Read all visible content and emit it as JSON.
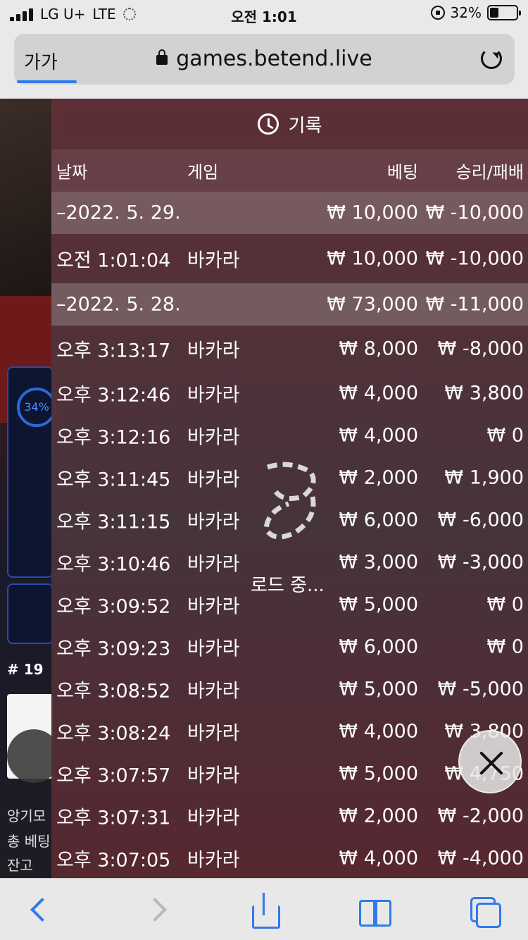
{
  "status_bar": {
    "carrier": "LG U+",
    "network": "LTE",
    "time": "오전 1:01",
    "battery": "32%",
    "battery_level": 0.32
  },
  "browser": {
    "text_size_label": "가가",
    "url": "games.betend.live",
    "load_progress": 0.12
  },
  "background_page": {
    "percent": "34%",
    "room_number": "# 19",
    "text1": "앙기모",
    "text2": "총 베팅",
    "text3": "잔고"
  },
  "history": {
    "title": "기록",
    "columns": {
      "date": "날짜",
      "game": "게임",
      "bet": "베팅",
      "result": "승리/패배"
    },
    "rows": [
      {
        "type": "date",
        "date": "–2022. 5. 29.",
        "game": "",
        "bet": "₩ 10,000",
        "result": "₩ -10,000"
      },
      {
        "type": "item",
        "date": "오전 1:01:04",
        "game": "바카라",
        "bet": "₩ 10,000",
        "result": "₩ -10,000"
      },
      {
        "type": "date",
        "date": "–2022. 5. 28.",
        "game": "",
        "bet": "₩ 73,000",
        "result": "₩ -11,000"
      },
      {
        "type": "item",
        "date": "오후 3:13:17",
        "game": "바카라",
        "bet": "₩ 8,000",
        "result": "₩ -8,000"
      },
      {
        "type": "item",
        "date": "오후 3:12:46",
        "game": "바카라",
        "bet": "₩ 4,000",
        "result": "₩ 3,800"
      },
      {
        "type": "item",
        "date": "오후 3:12:16",
        "game": "바카라",
        "bet": "₩ 4,000",
        "result": "₩ 0"
      },
      {
        "type": "item",
        "date": "오후 3:11:45",
        "game": "바카라",
        "bet": "₩ 2,000",
        "result": "₩ 1,900"
      },
      {
        "type": "item",
        "date": "오후 3:11:15",
        "game": "바카라",
        "bet": "₩ 6,000",
        "result": "₩ -6,000"
      },
      {
        "type": "item",
        "date": "오후 3:10:46",
        "game": "바카라",
        "bet": "₩ 3,000",
        "result": "₩ -3,000"
      },
      {
        "type": "item",
        "date": "오후 3:09:52",
        "game": "바카라",
        "bet": "₩ 5,000",
        "result": "₩ 0"
      },
      {
        "type": "item",
        "date": "오후 3:09:23",
        "game": "바카라",
        "bet": "₩ 6,000",
        "result": "₩ 0"
      },
      {
        "type": "item",
        "date": "오후 3:08:52",
        "game": "바카라",
        "bet": "₩ 5,000",
        "result": "₩ -5,000"
      },
      {
        "type": "item",
        "date": "오후 3:08:24",
        "game": "바카라",
        "bet": "₩ 4,000",
        "result": "₩ 3,800"
      },
      {
        "type": "item",
        "date": "오후 3:07:57",
        "game": "바카라",
        "bet": "₩ 5,000",
        "result": "₩ 4,750"
      },
      {
        "type": "item",
        "date": "오후 3:07:31",
        "game": "바카라",
        "bet": "₩ 2,000",
        "result": "₩ -2,000"
      },
      {
        "type": "item",
        "date": "오후 3:07:05",
        "game": "바카라",
        "bet": "₩ 4,000",
        "result": "₩ -4,000"
      }
    ]
  },
  "loader": {
    "text": "로드 중..."
  },
  "icons": {
    "history": "history-icon",
    "close": "close-icon",
    "back": "chevron-left-icon",
    "forward": "chevron-right-icon",
    "share": "share-icon",
    "bookmarks": "book-icon",
    "tabs": "tabs-icon"
  },
  "colors": {
    "accent": "#2f7bea",
    "panel": "#5f3037"
  }
}
